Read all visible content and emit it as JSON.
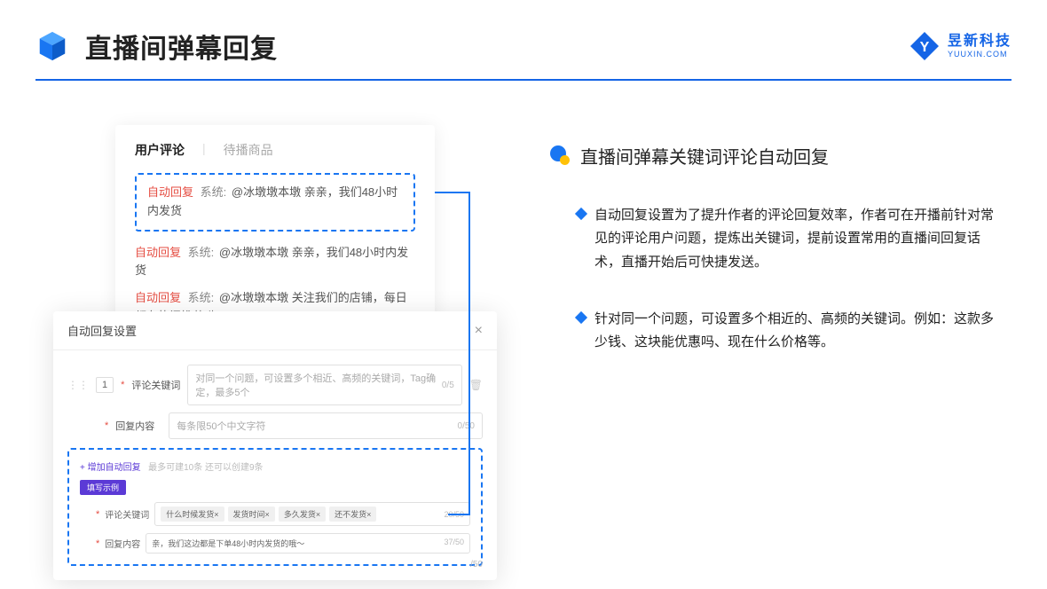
{
  "header": {
    "title": "直播间弹幕回复",
    "logo_cn": "昱新科技",
    "logo_en": "YUUXIN.COM"
  },
  "comment_panel": {
    "tab_active": "用户评论",
    "tab_inactive": "待播商品",
    "highlighted": {
      "auto": "自动回复",
      "sys": "系统:",
      "text": "@冰墩墩本墩 亲亲，我们48小时内发货"
    },
    "rows": [
      {
        "auto": "自动回复",
        "sys": "系统:",
        "text": "@冰墩墩本墩 亲亲，我们48小时内发货"
      },
      {
        "auto": "自动回复",
        "sys": "系统:",
        "text": "@冰墩墩本墩 关注我们的店铺，每日都有热门推荐呦～"
      }
    ]
  },
  "dialog": {
    "title": "自动回复设置",
    "num": "1",
    "field1_label": "评论关键词",
    "field1_placeholder": "对同一个问题，可设置多个相近、高频的关键词，Tag确定，最多5个",
    "field1_counter": "0/5",
    "field2_label": "回复内容",
    "field2_placeholder": "每条限50个中文字符",
    "field2_counter": "0/50",
    "add_link": "+ 增加自动回复",
    "add_hint": "最多可建10条 还可以创建9条",
    "example_badge": "填写示例",
    "ex_field1_label": "评论关键词",
    "ex_tags": [
      "什么时候发货×",
      "发货时间×",
      "多久发货×",
      "还不发货×"
    ],
    "ex_field1_counter": "20/50",
    "ex_field2_label": "回复内容",
    "ex_field2_value": "亲，我们这边都是下单48小时内发货的哦～",
    "ex_field2_counter": "37/50",
    "bottom_counter": "/50"
  },
  "right": {
    "section_title": "直播间弹幕关键词评论自动回复",
    "bullets": [
      "自动回复设置为了提升作者的评论回复效率，作者可在开播前针对常见的评论用户问题，提炼出关键词，提前设置常用的直播间回复话术，直播开始后可快捷发送。",
      "针对同一个问题，可设置多个相近的、高频的关键词。例如：这款多少钱、这块能优惠吗、现在什么价格等。"
    ]
  }
}
